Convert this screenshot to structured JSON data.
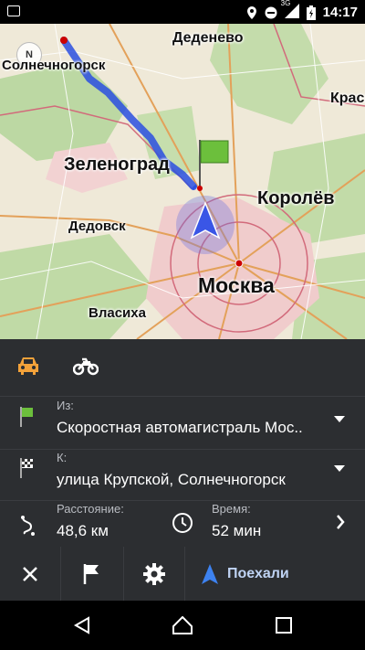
{
  "status_bar": {
    "network": "3G",
    "time": "14:17",
    "icons": [
      "image-icon",
      "location-icon",
      "dnd-icon",
      "signal-icon",
      "battery-charging-icon"
    ]
  },
  "map": {
    "compass_label": "N",
    "cities": {
      "dedenevo": "Деденево",
      "solnechnogorsk": "Солнечногорск",
      "krasn": "Красн",
      "zelenograd": "Зеленоград",
      "korolev": "Королёв",
      "dedovsk": "Дедовск",
      "moskva": "Москва",
      "vlasikha": "Власиха"
    },
    "colors": {
      "route": "#2a4fe0",
      "land": "#efe9d8",
      "forest": "#b9d7a0",
      "city": "#f0c8c8"
    }
  },
  "route_panel": {
    "vehicles": [
      "car-icon",
      "motorcycle-icon"
    ],
    "from": {
      "label": "Из:",
      "value": "Скоростная автомагистраль Мос.."
    },
    "to": {
      "label": "К:",
      "value": "улица Крупской, Солнечногорск"
    },
    "distance": {
      "label": "Расстояние:",
      "value": "48,6 км"
    },
    "time": {
      "label": "Время:",
      "value": "52 мин"
    },
    "go_label": "Поехали",
    "accent": "#f3a23a",
    "go_color": "#3d82f0"
  },
  "nav_bar": [
    "back-icon",
    "home-icon",
    "recents-icon"
  ]
}
